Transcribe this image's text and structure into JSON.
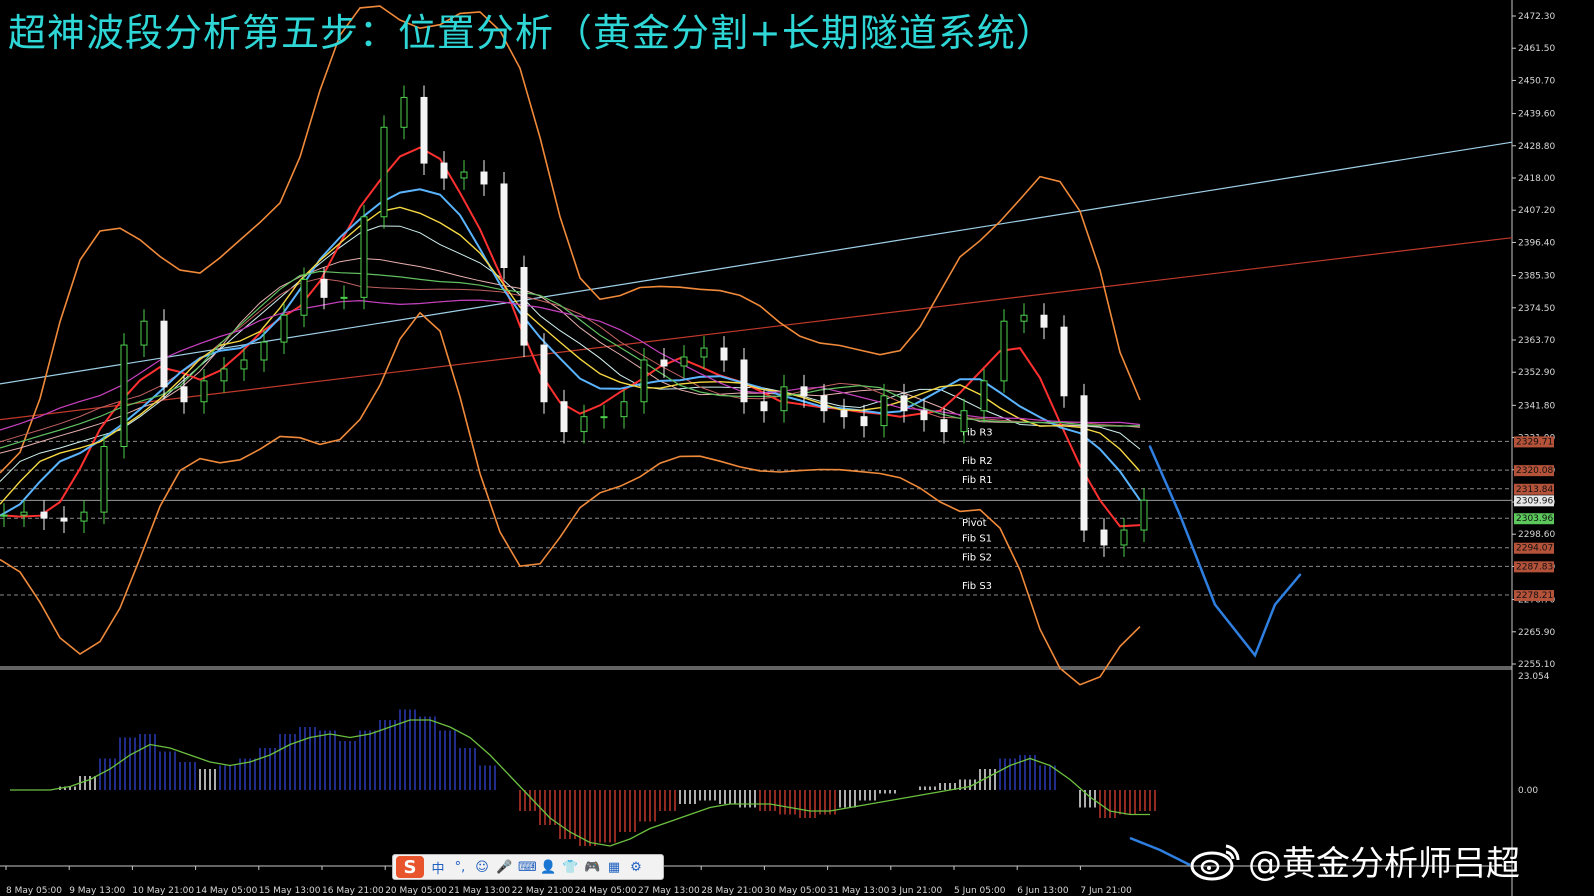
{
  "title": "超神波段分析第五步：位置分析（黄金分割+长期隧道系统）",
  "watermark": "@黄金分析师吕超",
  "ime_toolbar": {
    "logo": "S",
    "items": [
      "中",
      "°,",
      "☺",
      "🎤",
      "⌨",
      "👤",
      "👕",
      "🎮",
      "▦",
      "⚙"
    ]
  },
  "chart_data": {
    "type": "line",
    "symbol": "XAUUSD",
    "price_axis": {
      "ticks": [
        2472.3,
        2461.5,
        2450.7,
        2439.6,
        2428.8,
        2418.0,
        2407.2,
        2396.4,
        2385.3,
        2374.5,
        2363.7,
        2352.9,
        2341.8,
        2331.0,
        2320.2,
        2309.4,
        2298.6,
        2287.8,
        2276.7,
        2265.9,
        2255.1
      ],
      "range": [
        2255.1,
        2472.3
      ]
    },
    "x_axis": {
      "labels": [
        "8 May 05:00",
        "9 May 13:00",
        "10 May 21:00",
        "14 May 05:00",
        "15 May 13:00",
        "16 May 21:00",
        "20 May 05:00",
        "21 May 13:00",
        "22 May 21:00",
        "24 May 05:00",
        "27 May 13:00",
        "28 May 21:00",
        "30 May 05:00",
        "31 May 13:00",
        "3 Jun 21:00",
        "5 Jun 05:00",
        "6 Jun 13:00",
        "7 Jun 21:00"
      ]
    },
    "fib_levels": [
      {
        "name": "Fib R3",
        "price": 2329.71,
        "color": "#b5523a"
      },
      {
        "name": "Fib R2",
        "price": 2320.08,
        "color": "#b5523a"
      },
      {
        "name": "Fib R1",
        "price": 2313.84,
        "color": "#b5523a"
      },
      {
        "name": "Pivot",
        "price": 2303.96,
        "color": "#5cc85c"
      },
      {
        "name": "Fib S1",
        "price": 2294.07,
        "color": "#b5523a"
      },
      {
        "name": "Fib S2",
        "price": 2287.83,
        "color": "#b5523a"
      },
      {
        "name": "Fib S3",
        "price": 2278.21,
        "color": "#b5523a"
      }
    ],
    "current_price": 2309.96,
    "close_series": {
      "name": "",
      "x": [
        0,
        20,
        40,
        60,
        80,
        100,
        120,
        140,
        160,
        180,
        200,
        220,
        240,
        260,
        280,
        300,
        320,
        340,
        360,
        380,
        400,
        420,
        440,
        460,
        480,
        500,
        520,
        540,
        560,
        580,
        600,
        620,
        640,
        660,
        680,
        700,
        720,
        740,
        760,
        780,
        800,
        820,
        840,
        860,
        880,
        900,
        920,
        940,
        960,
        980,
        1000,
        1020,
        1040,
        1060,
        1080,
        1100,
        1120,
        1140
      ],
      "values": [
        2305,
        2306,
        2304,
        2303,
        2306,
        2328,
        2362,
        2370,
        2348,
        2343,
        2350,
        2354,
        2357,
        2363,
        2372,
        2384,
        2378,
        2378,
        2405,
        2435,
        2445,
        2423,
        2418,
        2420,
        2416,
        2388,
        2362,
        2343,
        2333,
        2338,
        2338,
        2343,
        2357,
        2355,
        2358,
        2361,
        2357,
        2343,
        2340,
        2348,
        2345,
        2340,
        2338,
        2335,
        2345,
        2340,
        2337,
        2333,
        2340,
        2350,
        2370,
        2372,
        2368,
        2345,
        2300,
        2295,
        2300,
        2310
      ]
    },
    "forecast_path": [
      [
        1150,
        2328
      ],
      [
        1180,
        2305
      ],
      [
        1215,
        2275
      ],
      [
        1255,
        2258
      ],
      [
        1275,
        2275
      ],
      [
        1300,
        2285
      ]
    ],
    "macd": {
      "zero_label": "0.00",
      "top_label": "23.054",
      "bars": [
        0,
        0,
        0,
        1,
        4,
        9,
        15,
        16,
        11,
        8,
        6,
        7,
        9,
        12,
        16,
        18,
        17,
        14,
        17,
        20,
        23,
        21,
        17,
        12,
        7,
        0,
        -6,
        -10,
        -14,
        -16,
        -15,
        -12,
        -9,
        -6,
        -4,
        -3,
        -4,
        -5,
        -6,
        -7,
        -8,
        -7,
        -5,
        -3,
        -1,
        0,
        1,
        2,
        3,
        6,
        9,
        10,
        7,
        0,
        -5,
        -8,
        -7,
        -6
      ],
      "signal": [
        0,
        0,
        0,
        1,
        3,
        6,
        10,
        13,
        12,
        10,
        8,
        7,
        8,
        10,
        13,
        15,
        16,
        15,
        16,
        18,
        20,
        20,
        18,
        15,
        10,
        4,
        -2,
        -8,
        -12,
        -15,
        -16,
        -14,
        -11,
        -9,
        -7,
        -5,
        -4,
        -4,
        -4,
        -5,
        -6,
        -6,
        -5,
        -4,
        -3,
        -2,
        -1,
        0,
        1,
        4,
        7,
        9,
        7,
        3,
        -2,
        -6,
        -7,
        -7
      ]
    },
    "grid": false
  }
}
